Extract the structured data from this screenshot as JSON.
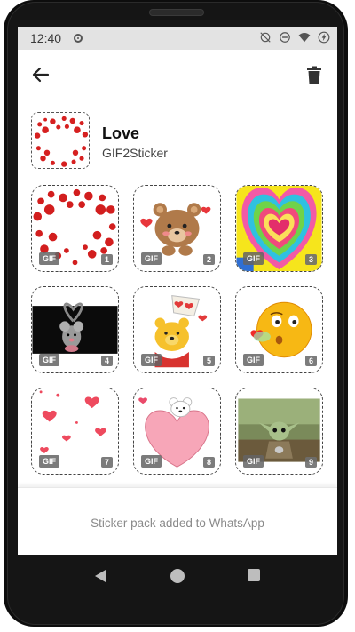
{
  "status_bar": {
    "time": "12:40",
    "icons": [
      "notification-dot-icon",
      "alarm-off-icon",
      "do-not-disturb-icon",
      "wifi-icon",
      "battery-charging-icon"
    ]
  },
  "app_bar": {
    "back_icon": "arrow-left-icon",
    "delete_icon": "trash-icon"
  },
  "pack": {
    "title": "Love",
    "publisher": "GIF2Sticker",
    "tray_icon": "heart-glitter"
  },
  "stickers": [
    {
      "index": "1",
      "badge": "GIF",
      "art": "glitter-heart"
    },
    {
      "index": "2",
      "badge": "GIF",
      "art": "teddy-bear-hearts"
    },
    {
      "index": "3",
      "badge": "GIF",
      "art": "rainbow-hearts"
    },
    {
      "index": "4",
      "badge": "GIF",
      "art": "mouse-heart-tail"
    },
    {
      "index": "5",
      "badge": "GIF",
      "art": "winnie-pooh-hearts"
    },
    {
      "index": "6",
      "badge": "GIF",
      "art": "kissing-emoji"
    },
    {
      "index": "7",
      "badge": "GIF",
      "art": "floating-hearts"
    },
    {
      "index": "8",
      "badge": "GIF",
      "art": "bear-on-heart"
    },
    {
      "index": "9",
      "badge": "GIF",
      "art": "baby-yoda"
    }
  ],
  "footer": {
    "status_text": "Sticker pack added to WhatsApp"
  },
  "nav_bar": {
    "icons": [
      "nav-back-icon",
      "nav-home-icon",
      "nav-recents-icon"
    ]
  },
  "colors": {
    "status_bar_bg": "#e3e3e3",
    "phone_frame": "#151515",
    "badge_bg": "#646464",
    "footer_text": "#8a8a8a"
  }
}
